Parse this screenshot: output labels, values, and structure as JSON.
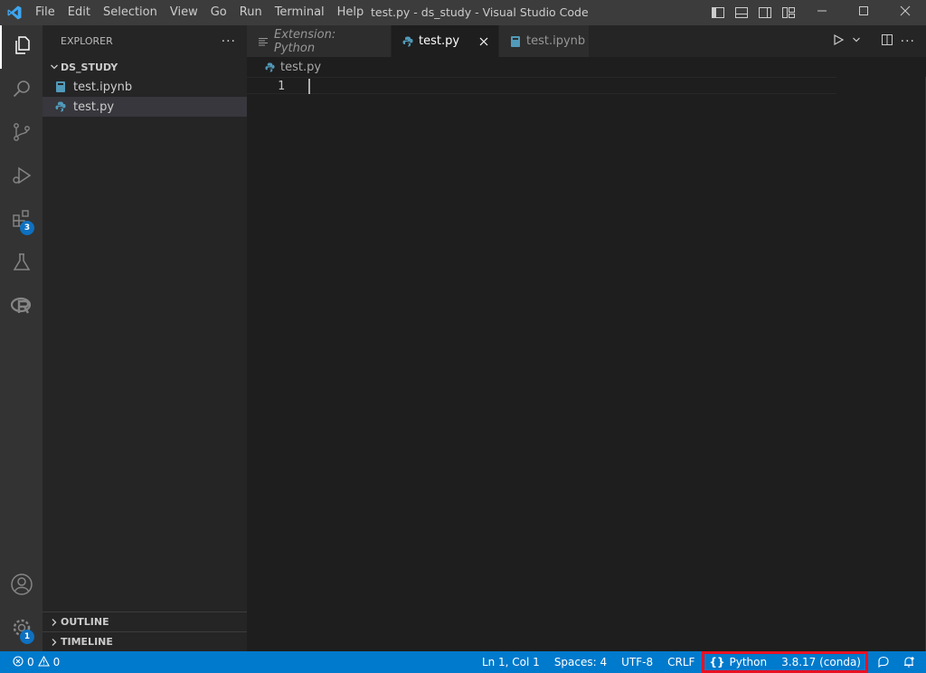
{
  "titlebar": {
    "menu": [
      "File",
      "Edit",
      "Selection",
      "View",
      "Go",
      "Run",
      "Terminal",
      "Help"
    ],
    "title": "test.py - ds_study - Visual Studio Code"
  },
  "activitybar": {
    "extensions_badge": "3",
    "settings_badge": "1"
  },
  "sidebar": {
    "header": "EXPLORER",
    "more": "···",
    "folder": "DS_STUDY",
    "files": [
      "test.ipynb",
      "test.py"
    ],
    "outline": "OUTLINE",
    "timeline": "TIMELINE"
  },
  "tabs": [
    {
      "label": "Extension: Python"
    },
    {
      "label": "test.py"
    },
    {
      "label": "test.ipynb"
    }
  ],
  "breadcrumb": "test.py",
  "editor": {
    "line_number": "1"
  },
  "statusbar": {
    "errors": "0",
    "warnings": "0",
    "position": "Ln 1, Col 1",
    "spaces": "Spaces: 4",
    "encoding": "UTF-8",
    "eol": "CRLF",
    "language": "Python",
    "interpreter": "3.8.17 (conda)"
  },
  "colors": {
    "accent": "#007acc",
    "highlight_box": "#e81123",
    "badge": "#0e70c0"
  }
}
